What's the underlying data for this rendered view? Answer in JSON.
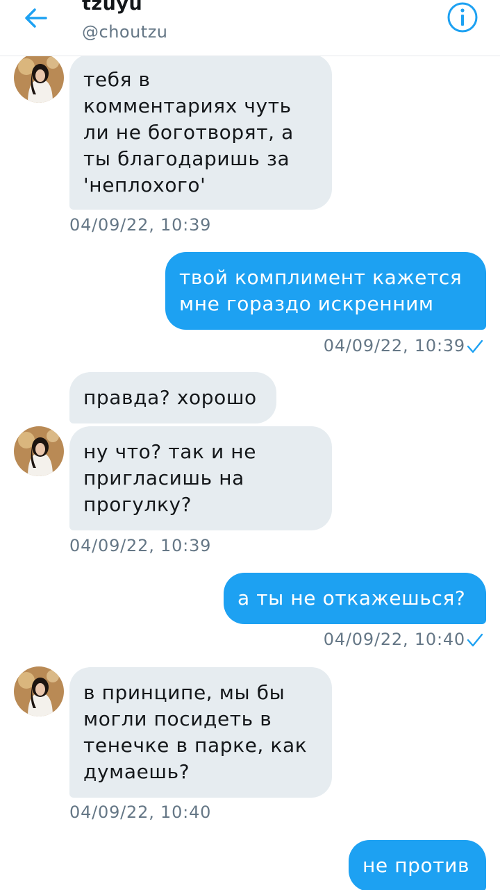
{
  "header": {
    "display_name": "tzuyu",
    "handle": "@choutzu",
    "back_icon": "arrow-left-icon",
    "info_icon": "info-icon",
    "accent_color": "#1da1f2"
  },
  "messages": [
    {
      "direction": "in",
      "text": "тебя в\nкомментариях чуть\nли не боготворят, а\nты благодаришь за\n'неплохого'",
      "timestamp": "04/09/22, 10:39",
      "avatar": true
    },
    {
      "direction": "out",
      "text": "твой комплимент кажется\nмне гораздо искренним",
      "timestamp": "04/09/22, 10:39",
      "read": true
    },
    {
      "direction": "in",
      "text": "правда? хорошо",
      "avatar": false
    },
    {
      "direction": "in",
      "text": "ну что? так и не\nпригласишь на\nпрогулку?",
      "timestamp": "04/09/22, 10:39",
      "avatar": true
    },
    {
      "direction": "out",
      "text": "а ты не откажешься?",
      "timestamp": "04/09/22, 10:40",
      "read": true
    },
    {
      "direction": "in",
      "text": "в принципе, мы бы\nмогли посидеть в\nтенечке в парке, как\nдумаешь?",
      "timestamp": "04/09/22, 10:40",
      "avatar": true
    },
    {
      "direction": "out",
      "text": "не против"
    }
  ]
}
